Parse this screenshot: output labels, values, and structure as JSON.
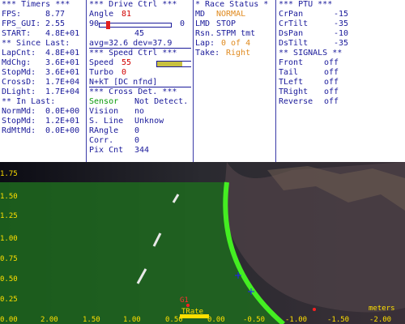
{
  "timers": {
    "header": "*** Timers ***",
    "rows": [
      {
        "label": "FPS:",
        "value": "8.77"
      },
      {
        "label": "FPS_GUI:",
        "value": "2.55"
      },
      {
        "label": "START:",
        "value": "4.8E+01"
      }
    ],
    "since_header": "** Since Last:",
    "since_rows": [
      {
        "label": "LapCnt:",
        "value": "4.8E+01"
      },
      {
        "label": "MdChg:",
        "value": "3.6E+01"
      },
      {
        "label": "StopMd:",
        "value": "3.6E+01"
      },
      {
        "label": "CrossD:",
        "value": "1.7E+04"
      },
      {
        "label": "DLight:",
        "value": "1.7E+04"
      }
    ],
    "in_header": "** In Last:",
    "in_rows": [
      {
        "label": "NormMd:",
        "value": "0.0E+00"
      },
      {
        "label": "StopMd:",
        "value": "1.2E+01"
      },
      {
        "label": "RdMtMd:",
        "value": "0.0E+00"
      }
    ]
  },
  "drive": {
    "header": "*** Drive Ctrl ***",
    "angle_label": "Angle",
    "angle_value": "81",
    "slider_left": "90",
    "slider_right": "0",
    "slider_fraction": 0.1,
    "slider_mid": "45",
    "avg_dev": "avg=32.6  dev=37.9",
    "speed_header": "*** Speed Ctrl ***",
    "speed_label": "Speed",
    "speed_value": "55",
    "speed_fraction": 0.55,
    "turbo_label": "Turbo",
    "turbo_value": "0",
    "nkt": "N+kT [DC nfnd]"
  },
  "cross": {
    "header": "*** Cross Det. ***",
    "rows": [
      {
        "label": "Sensor",
        "value": "Not Detect."
      },
      {
        "label": "Vision",
        "value": "no"
      },
      {
        "label": "S. Line",
        "value": "Unknow"
      },
      {
        "label": "RAngle",
        "value": "0"
      },
      {
        "label": "Corr.",
        "value": "0"
      },
      {
        "label": "Pix Cnt",
        "value": "344"
      }
    ]
  },
  "race": {
    "header": "* Race Status *",
    "rows": [
      {
        "label": "MD",
        "value": "NORMAL"
      },
      {
        "label": "LMD",
        "value": "STOP"
      },
      {
        "label": "Rsn.",
        "value": "STPM tmt"
      },
      {
        "label": "Lap:",
        "value": "0 of 4"
      },
      {
        "label": "Take:",
        "value": "Right"
      }
    ]
  },
  "ptu": {
    "header": "*** PTU ***",
    "rows": [
      {
        "label": "CrPan",
        "value": "-15"
      },
      {
        "label": "CrTilt",
        "value": "-35"
      },
      {
        "label": "DsPan",
        "value": "-10"
      },
      {
        "label": "DsTilt",
        "value": "-35"
      }
    ],
    "signals_header": "** SIGNALS **",
    "signals": [
      {
        "label": "Front",
        "value": "off"
      },
      {
        "label": "Tail",
        "value": "off"
      },
      {
        "label": "TLeft",
        "value": "off"
      },
      {
        "label": "TRight",
        "value": "off"
      },
      {
        "label": "Reverse",
        "value": "off"
      }
    ]
  },
  "view": {
    "y_labels": [
      "1.75",
      "1.50",
      "1.25",
      "1.00",
      "0.75",
      "0.50",
      "0.25",
      "0.00"
    ],
    "x_labels": [
      "2.00",
      "1.50",
      "1.00",
      "0.50",
      "0.00",
      "-0.50",
      "-1.00",
      "-1.50",
      "-2.00"
    ],
    "units": "meters",
    "marker_label_1": "G1",
    "marker_label_2": "TRate",
    "colors": {
      "grid_label": "#ffe000",
      "overlay": "#1e6a1e",
      "boundary": "#44ee22",
      "marker": "#2020ff"
    }
  }
}
